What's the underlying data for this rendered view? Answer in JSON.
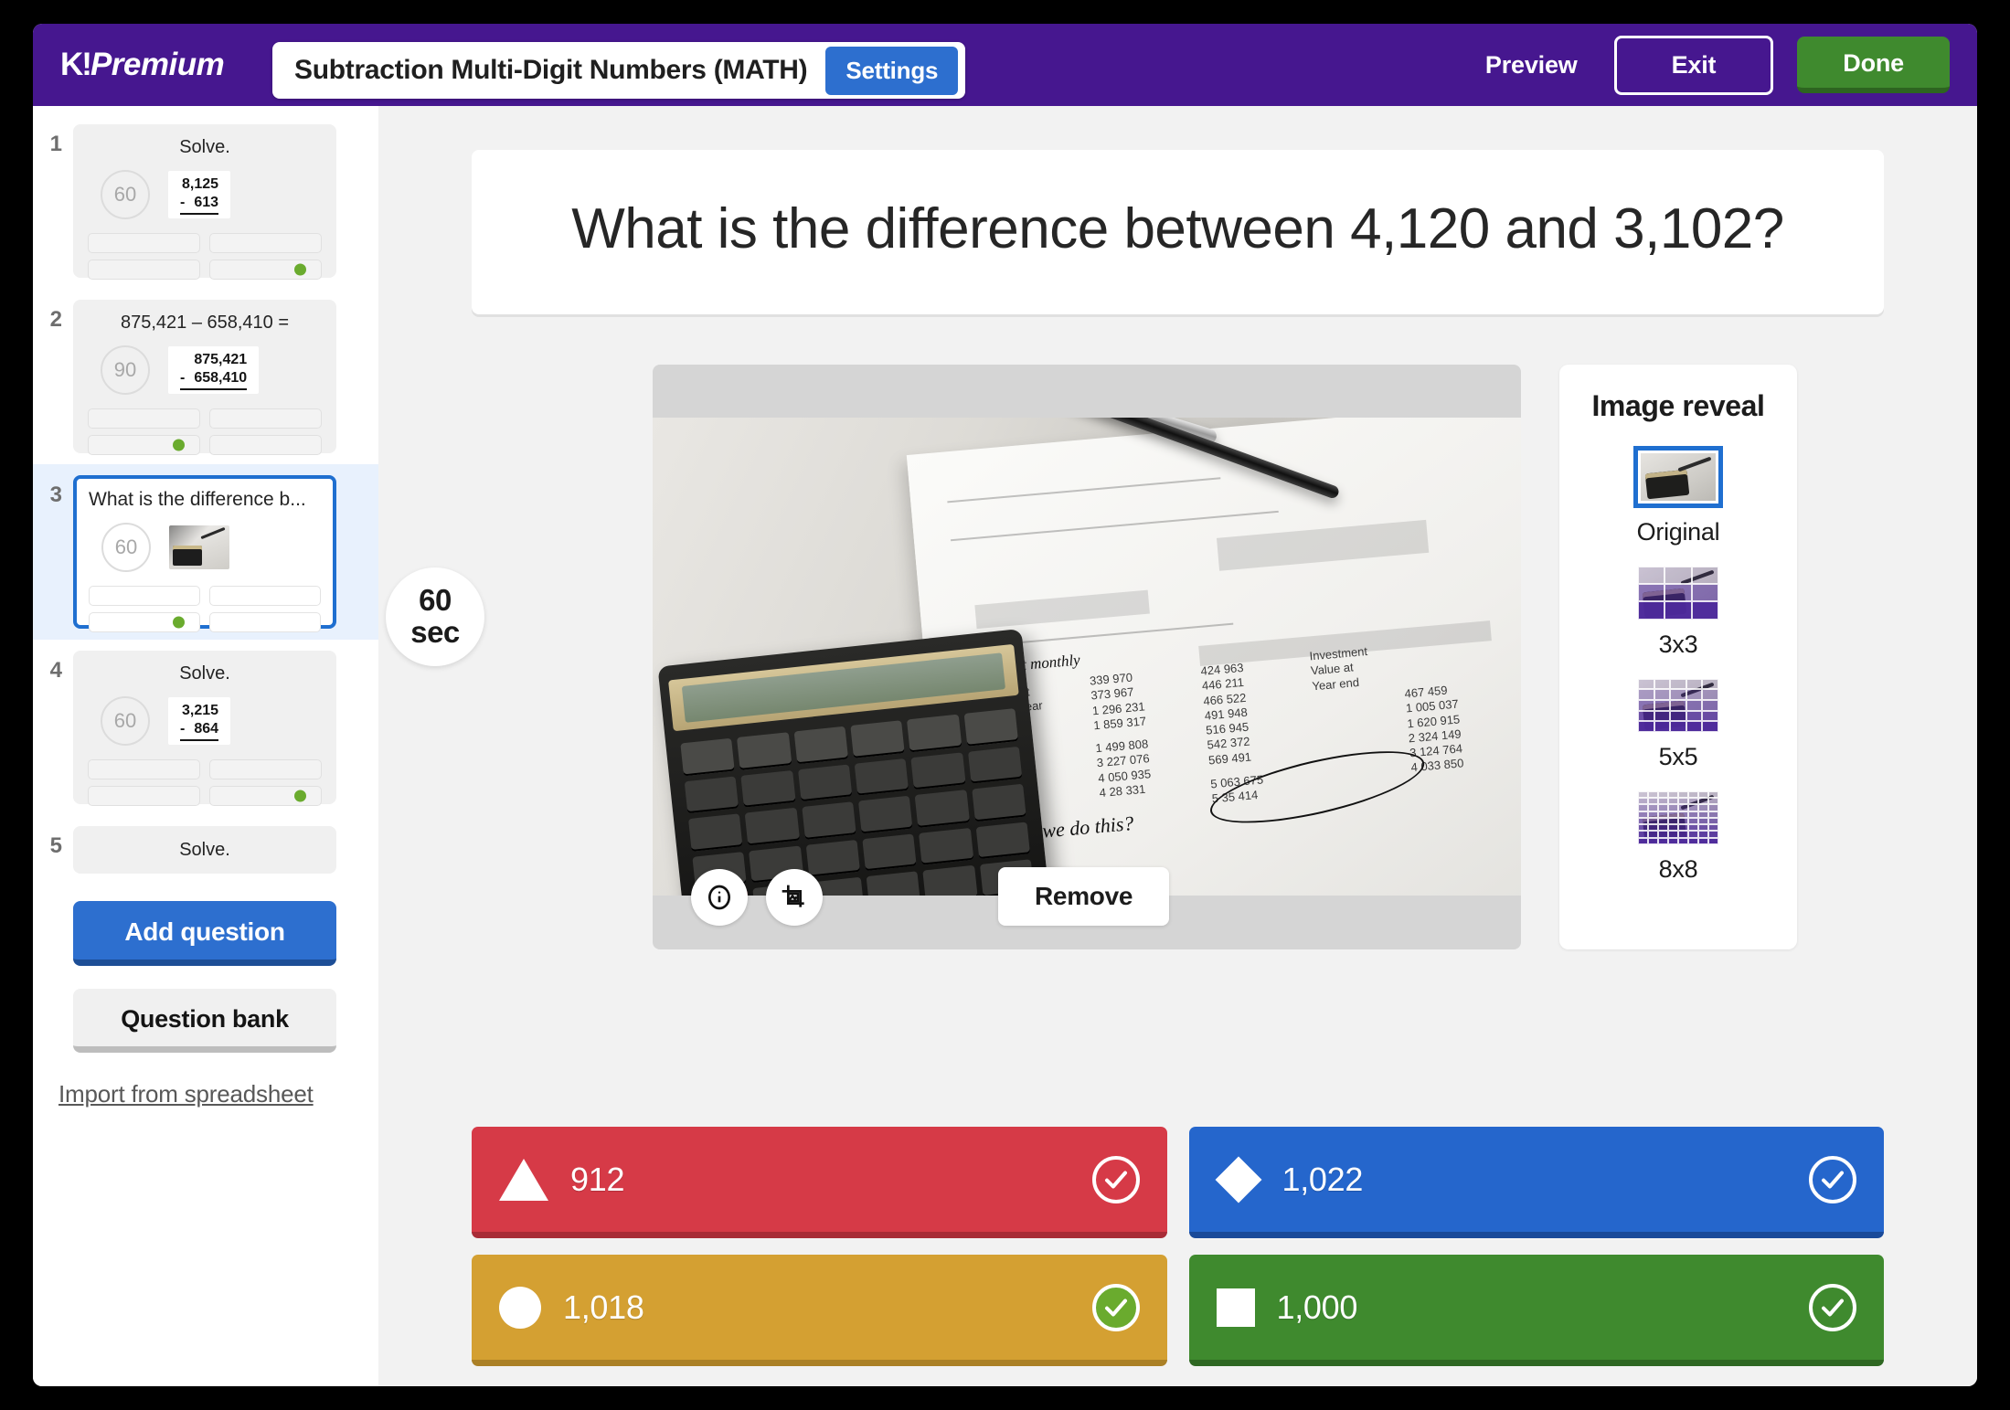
{
  "header": {
    "logo_k": "K!",
    "logo_word": "Premium",
    "quiz_title": "Subtraction Multi-Digit Numbers (MATH)",
    "settings_label": "Settings",
    "preview_label": "Preview",
    "exit_label": "Exit",
    "done_label": "Done",
    "brand_purple": "#46178F",
    "settings_blue": "#2D6FCF",
    "done_green": "#3F8A2E"
  },
  "sidebar": {
    "slides": [
      {
        "number": "1",
        "title": "Solve.",
        "time": "60",
        "math_top": "8,125",
        "math_minus": "-",
        "math_bottom": "613",
        "correct_index": 3,
        "selected": false,
        "has_image": false,
        "compact": false
      },
      {
        "number": "2",
        "title": "875,421 – 658,410 =",
        "time": "90",
        "math_top": "875,421",
        "math_minus": "-",
        "math_bottom": "658,410",
        "correct_index": 2,
        "selected": false,
        "has_image": false,
        "compact": false
      },
      {
        "number": "3",
        "title": "What is the difference b...",
        "time": "60",
        "math_top": "",
        "math_minus": "",
        "math_bottom": "",
        "correct_index": 2,
        "selected": true,
        "has_image": true,
        "compact": false
      },
      {
        "number": "4",
        "title": "Solve.",
        "time": "60",
        "math_top": "3,215",
        "math_minus": "-",
        "math_bottom": "864",
        "correct_index": 3,
        "selected": false,
        "has_image": false,
        "compact": false
      },
      {
        "number": "5",
        "title": "Solve.",
        "time": "",
        "math_top": "",
        "math_minus": "",
        "math_bottom": "",
        "correct_index": -1,
        "selected": false,
        "has_image": false,
        "compact": true
      }
    ],
    "add_question_label": "Add question",
    "question_bank_label": "Question bank",
    "import_label": "Import from spreadsheet"
  },
  "main": {
    "question_text": "What is the difference between 4,120 and 3,102?",
    "timer_value": "60",
    "timer_unit": "sec",
    "remove_label": "Remove",
    "info_icon": "info-icon",
    "crop_icon": "crop-image-icon"
  },
  "image_reveal": {
    "title": "Image reveal",
    "options": [
      {
        "label": "Original",
        "grid": 0,
        "selected": true
      },
      {
        "label": "3x3",
        "grid": 3,
        "selected": false
      },
      {
        "label": "5x5",
        "grid": 5,
        "selected": false
      },
      {
        "label": "8x8",
        "grid": 8,
        "selected": false
      }
    ]
  },
  "answers": [
    {
      "shape": "triangle",
      "color": "red",
      "text": "912",
      "correct": false
    },
    {
      "shape": "diamond",
      "color": "blue",
      "text": "1,022",
      "correct": false
    },
    {
      "shape": "circle",
      "color": "yellow",
      "text": "1,018",
      "correct": true
    },
    {
      "shape": "square",
      "color": "green",
      "text": "1,000",
      "correct": false
    }
  ]
}
